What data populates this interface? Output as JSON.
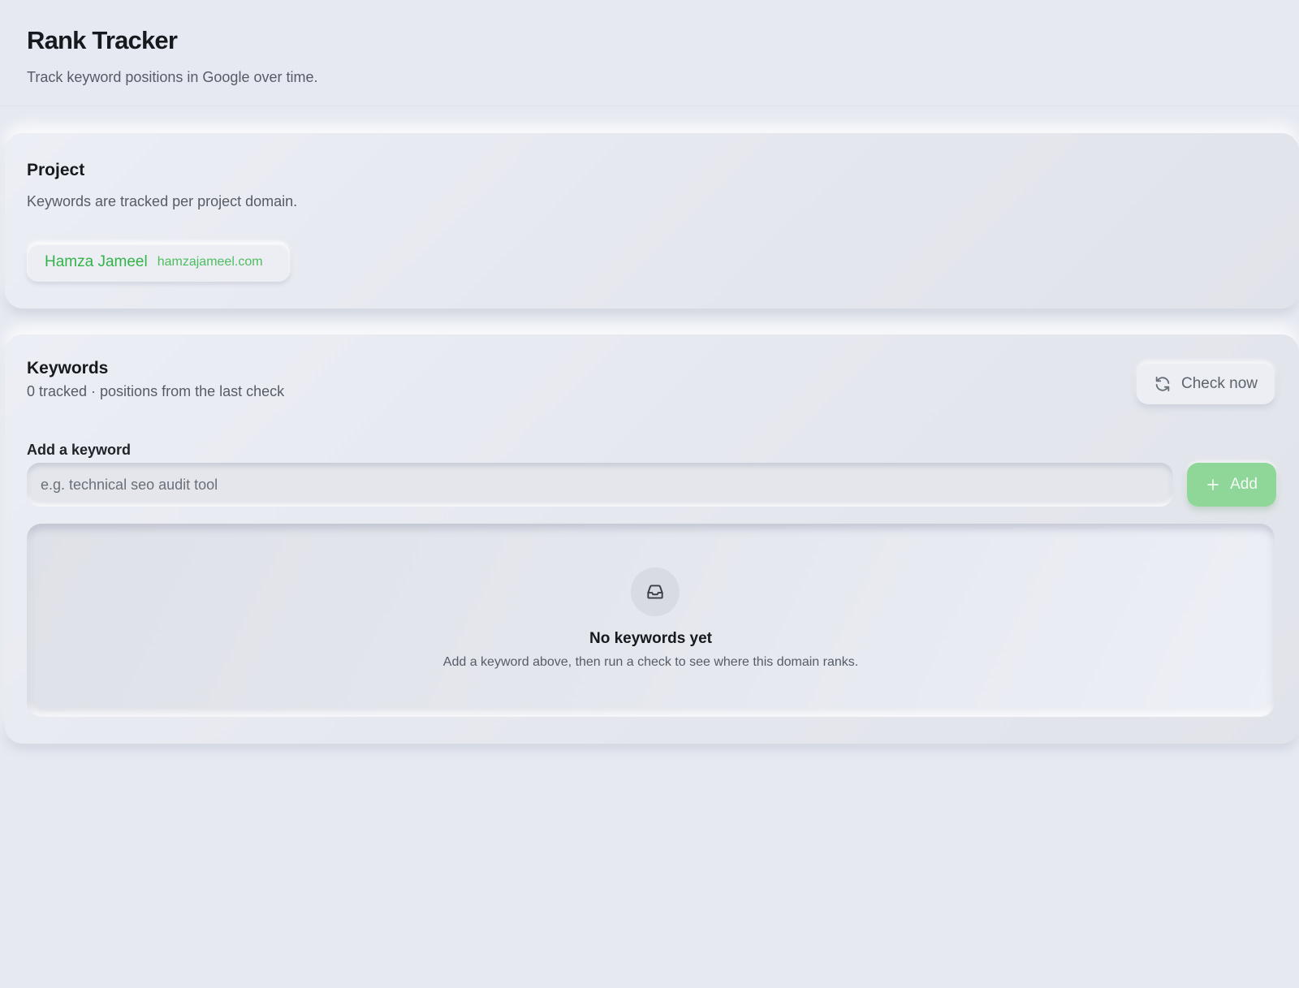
{
  "header": {
    "title": "Rank Tracker",
    "subtitle": "Track keyword positions in Google over time."
  },
  "project": {
    "title": "Project",
    "description": "Keywords are tracked per project domain.",
    "chip": {
      "name": "Hamza Jameel",
      "domain": "hamzajameel.com"
    }
  },
  "keywords": {
    "title": "Keywords",
    "summary": "0 tracked · positions from the last check",
    "check_button_label": "Check now",
    "check_button_icon": "refresh-icon",
    "add_label": "Add a keyword",
    "input_value": "",
    "input_placeholder": "e.g. technical seo audit tool",
    "add_button_label": "Add",
    "add_button_icon": "plus-icon",
    "empty": {
      "icon": "inbox-icon",
      "title": "No keywords yet",
      "description": "Add a keyword above, then run a check to see where this domain ranks."
    }
  },
  "colors": {
    "background": "#e6e9f1",
    "accent_green": "#33b34a",
    "add_button": "#8fd699",
    "text_primary": "#16191d",
    "text_secondary": "#565c66"
  }
}
